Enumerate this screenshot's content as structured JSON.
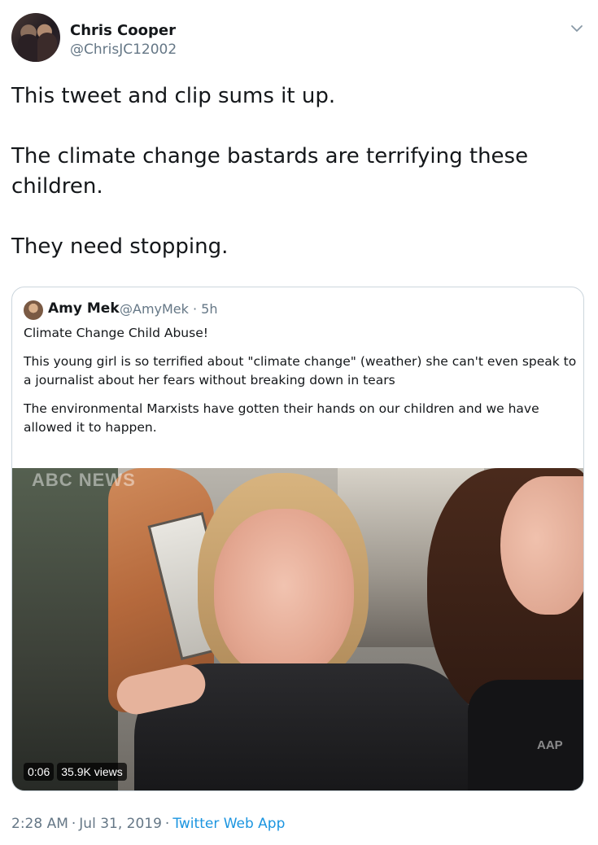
{
  "tweet": {
    "author": {
      "name": "Chris Cooper",
      "handle": "@ChrisJC12002"
    },
    "text": [
      "This tweet and clip sums it up.",
      "The climate change bastards are terrifying these children.",
      "They need stopping."
    ],
    "quoted": {
      "author": {
        "name": "Amy Mek",
        "handle": "@AmyMek · 5h"
      },
      "text": [
        "Climate Change Child Abuse!",
        "This young girl is so terrified about \"climate change\" (weather) she can't even speak to a journalist about her fears without breaking down in tears",
        "The environmental Marxists have gotten their hands on our children and we have allowed it to happen."
      ],
      "media": {
        "duration": "0:06",
        "views": "35.9K views",
        "watermark": "ABC NEWS",
        "corner_logo": "AAP"
      }
    },
    "meta": {
      "time": "2:28 AM",
      "date": "Jul 31, 2019",
      "source": "Twitter Web App"
    }
  },
  "icons": {
    "menu": "chevron-down-icon"
  },
  "colors": {
    "secondary_text": "#657786",
    "link": "#1b95e0",
    "border": "#ccd6dd"
  }
}
